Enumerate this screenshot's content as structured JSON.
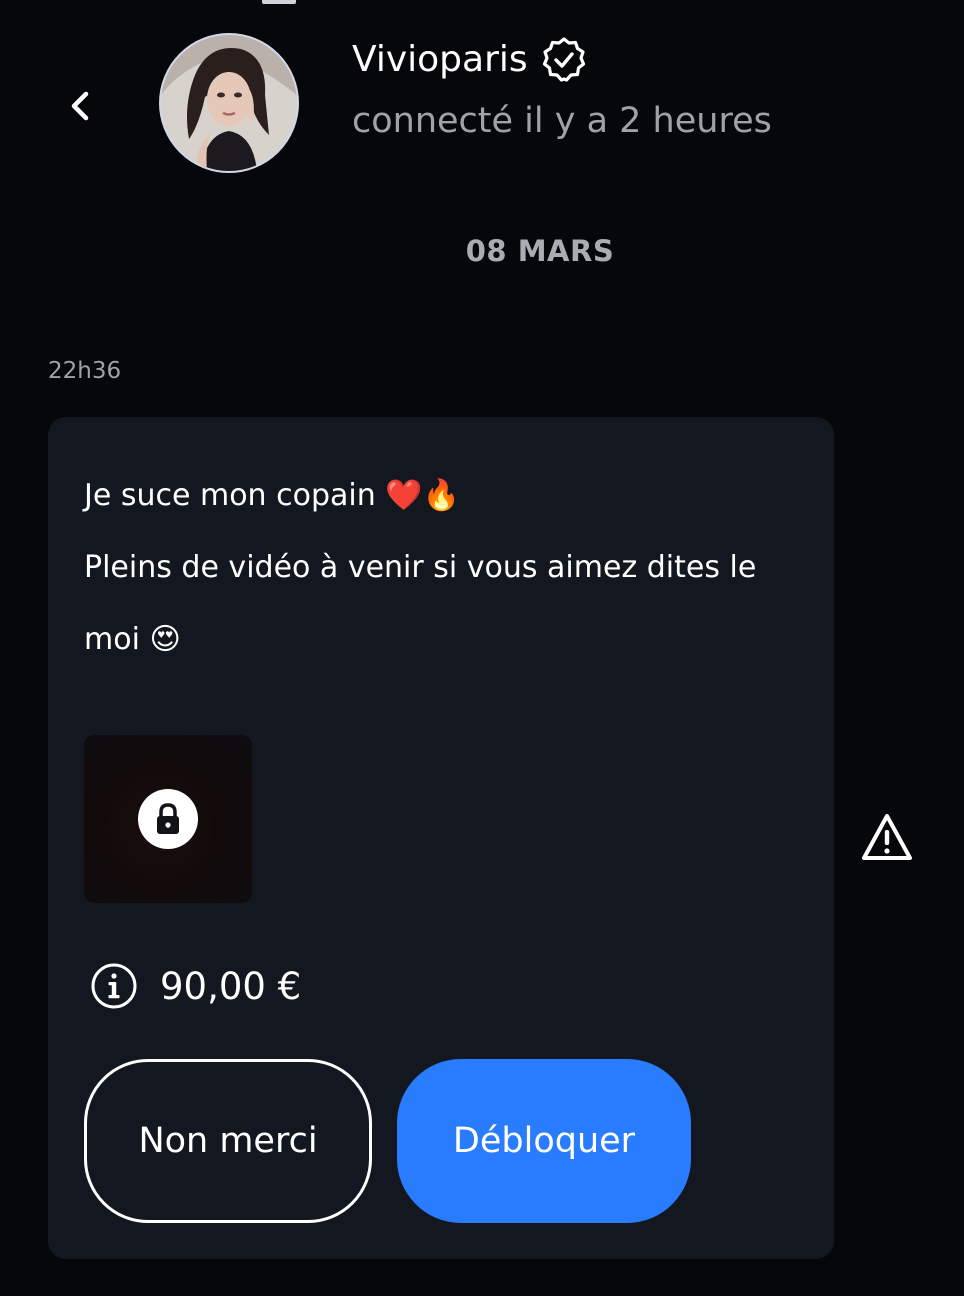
{
  "header": {
    "back_icon": "chevron-left-icon",
    "avatar_icon": "profile-photo",
    "user_name": "Vivioparis",
    "verified_icon": "verified-badge-icon",
    "status": "connecté il y a 2 heures"
  },
  "conversation": {
    "date_label": "08 MARS",
    "message": {
      "time": "22h36",
      "line1": "Je suce mon copain ❤️🔥",
      "line2": "Pleins de vidéo à venir si vous aimez dites le moi 😍",
      "media": {
        "locked": true,
        "lock_icon": "lock-icon"
      },
      "price_icon": "info-icon",
      "price": "90,00 €",
      "decline_label": "Non merci",
      "unlock_label": "Débloquer",
      "report_icon": "warning-icon"
    }
  },
  "colors": {
    "background": "#06070b",
    "bubble": "#131820",
    "accent": "#2a7cff",
    "muted_text": "#9ea2a9"
  }
}
